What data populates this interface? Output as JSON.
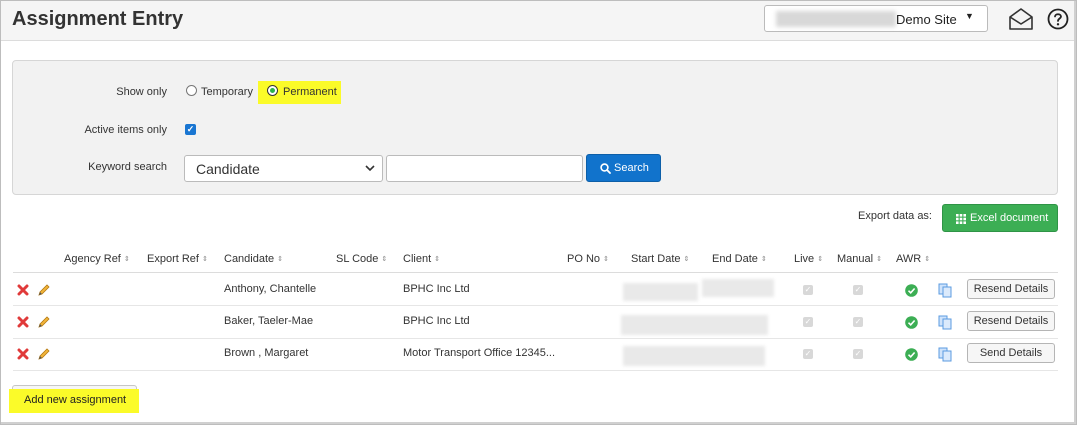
{
  "header": {
    "title": "Assignment Entry",
    "site_label": "Demo Site"
  },
  "filters": {
    "show_only_label": "Show only",
    "option_temporary": "Temporary",
    "option_permanent": "Permanent",
    "selected": "Permanent",
    "active_only_label": "Active items only",
    "active_only_checked": true,
    "keyword_label": "Keyword search",
    "keyword_field": "Candidate",
    "keyword_value": "",
    "search_label": "Search"
  },
  "export": {
    "label": "Export data as:",
    "excel_label": "Excel document"
  },
  "table": {
    "columns": [
      "Agency Ref",
      "Export Ref",
      "Candidate",
      "SL Code",
      "Client",
      "PO No",
      "Start Date",
      "End Date",
      "Live",
      "Manual",
      "AWR"
    ],
    "rows": [
      {
        "candidate": "Anthony, Chantelle",
        "client": "BPHC Inc Ltd",
        "action": "Resend Details"
      },
      {
        "candidate": "Baker, Taeler-Mae",
        "client": "BPHC Inc Ltd",
        "action": "Resend Details"
      },
      {
        "candidate": "Brown , Margaret",
        "client": "Motor Transport Office 12345...",
        "action": "Send Details"
      }
    ]
  },
  "add_button_label": "Add new assignment",
  "colors": {
    "highlight": "#fbfb29",
    "search_button": "#1173cc",
    "excel_button": "#3cae54",
    "delete_icon": "#e03a3a",
    "awr_ok": "#3cae54"
  }
}
